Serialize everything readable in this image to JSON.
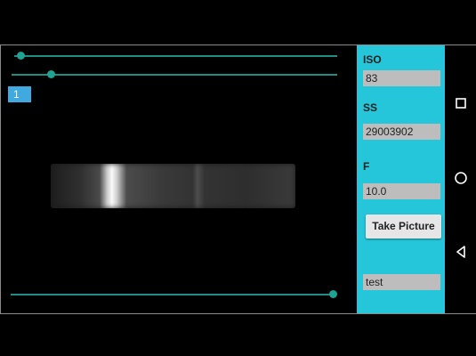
{
  "preview": {
    "sliders": [
      {
        "name": "top-slider-1",
        "value": 0.02
      },
      {
        "name": "top-slider-2",
        "value": 0.12
      },
      {
        "name": "bottom-slider",
        "value": 0.99
      }
    ],
    "badge": "1"
  },
  "panel": {
    "iso_label": "ISO",
    "iso_value": "83",
    "ss_label": "SS",
    "ss_value": "29003902",
    "f_label": "F",
    "f_value": "10.0",
    "take_picture_label": "Take Picture",
    "name_value": "test"
  },
  "navbar": {
    "icons": [
      "recents-icon",
      "home-icon",
      "back-icon"
    ]
  },
  "colors": {
    "panel": "#26c6da",
    "slider": "#1fa393",
    "badge": "#3fa9e0"
  }
}
